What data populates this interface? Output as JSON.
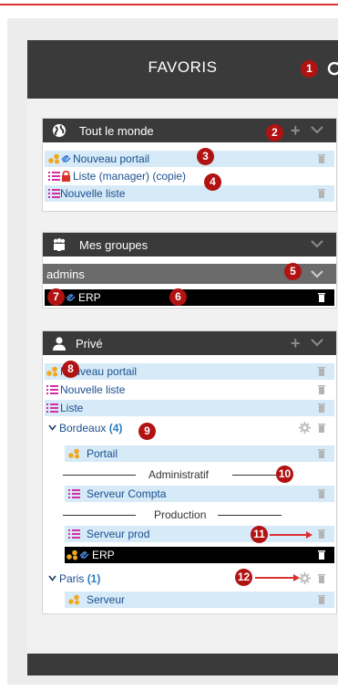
{
  "header": {
    "title": "FAVORIS"
  },
  "sections": {
    "everyone": {
      "title": "Tout le monde",
      "items": [
        {
          "label": "Nouveau portail",
          "type": "portal-link"
        },
        {
          "label": "Liste (manager) (copie)",
          "type": "list-locked"
        },
        {
          "label": "Nouvelle liste",
          "type": "list"
        }
      ]
    },
    "groups": {
      "title": "Mes groupes",
      "group_name": "admins",
      "items": [
        {
          "label": "ERP",
          "type": "link"
        }
      ]
    },
    "private": {
      "title": "Privé",
      "items": [
        {
          "label": "Nouveau portail"
        },
        {
          "label": "Nouvelle liste"
        },
        {
          "label": "Liste"
        }
      ],
      "folder_bordeaux": {
        "name": "Bordeaux",
        "count": "(4)",
        "items": [
          {
            "label": "Portail"
          },
          {
            "label": "Serveur Compta"
          },
          {
            "label": "Serveur prod"
          },
          {
            "label": "ERP"
          }
        ],
        "separators": [
          "Administratif",
          "Production"
        ]
      },
      "folder_paris": {
        "name": "Paris",
        "count": "(1)",
        "items": [
          {
            "label": "Serveur"
          }
        ]
      }
    }
  },
  "callouts": [
    "1",
    "2",
    "3",
    "4",
    "5",
    "6",
    "7",
    "8",
    "9",
    "10",
    "11",
    "12"
  ],
  "colors": {
    "dark": "#3a3a3a",
    "row_blue": "#d6eaf7",
    "badge": "#b11212",
    "accent_red": "#e0302e",
    "link_blue": "#1a4f8f"
  }
}
